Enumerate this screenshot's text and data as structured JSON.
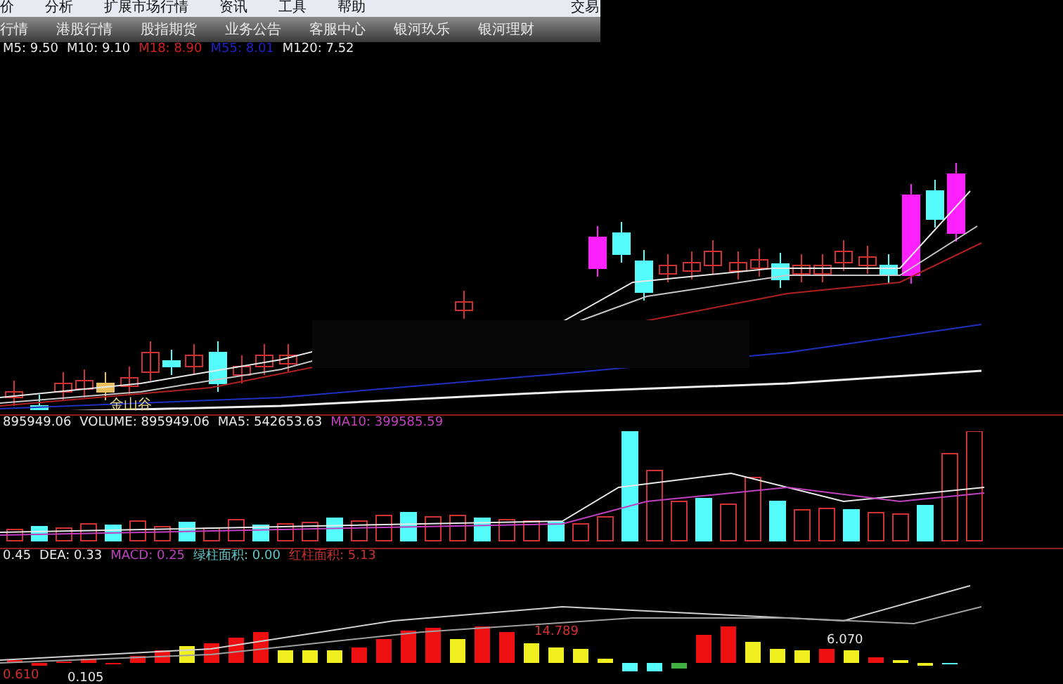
{
  "menu_bar": {
    "items": [
      "价",
      "分析",
      "扩展市场行情",
      "资讯",
      "工具",
      "帮助"
    ],
    "right_label": "交易"
  },
  "nav_tabs": [
    "行情",
    "港股行情",
    "股指期货",
    "业务公告",
    "客服中心",
    "银河玖乐",
    "银河理财"
  ],
  "price_legend": [
    {
      "text": "M5: 9.50",
      "color": "#e8e8e8"
    },
    {
      "text": "M10: 9.10",
      "color": "#e8e8e8"
    },
    {
      "text": "M18: 8.90",
      "color": "#d02020"
    },
    {
      "text": "M55: 8.01",
      "color": "#2020c8"
    },
    {
      "text": "M120: 7.52",
      "color": "#e8e8e8"
    }
  ],
  "price_annotation": "金山谷",
  "volume_legend": [
    {
      "text": "895949.06",
      "color": "#e8e8e8"
    },
    {
      "text": "VOLUME: 895949.06",
      "color": "#e8e8e8"
    },
    {
      "text": "MA5: 542653.63",
      "color": "#e8e8e8"
    },
    {
      "text": "MA10: 399585.59",
      "color": "#c040c0"
    }
  ],
  "macd_legend": [
    {
      "text": "0.45",
      "color": "#e8e8e8"
    },
    {
      "text": "DEA: 0.33",
      "color": "#e8e8e8"
    },
    {
      "text": "MACD: 0.25",
      "color": "#c040c0"
    },
    {
      "text": "绿柱面积: 0.00",
      "color": "#60c8c8"
    },
    {
      "text": "红柱面积: 5.13",
      "color": "#c83030"
    }
  ],
  "macd_labels": [
    "0.610",
    "0.105",
    "14.789",
    "6.070"
  ]
}
